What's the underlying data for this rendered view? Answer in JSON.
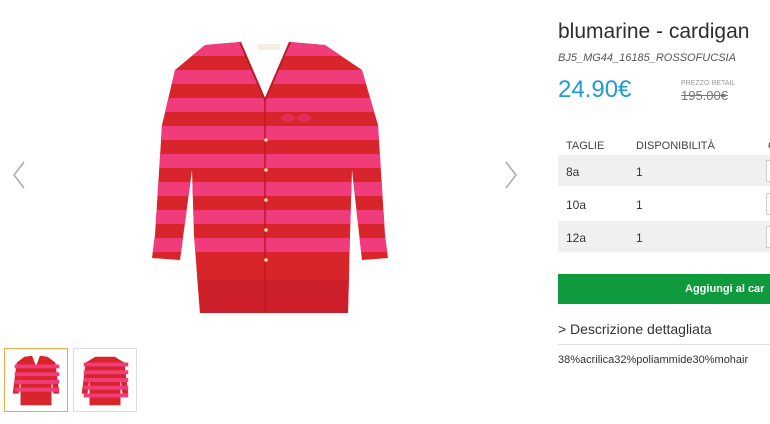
{
  "product": {
    "title": "blumarine - cardigan",
    "sku": "BJ5_MG44_16185_ROSSOFUCSIA",
    "price": "24.90€",
    "retail_label": "PREZZO RETAIL",
    "retail_price": "195.00€"
  },
  "sizes_table": {
    "headers": [
      "TAGLIE",
      "DISPONIBILITÀ",
      "Q"
    ],
    "rows": [
      {
        "size": "8a",
        "availability": "1"
      },
      {
        "size": "10a",
        "availability": "1"
      },
      {
        "size": "12a",
        "availability": "1"
      }
    ]
  },
  "cart_button": {
    "label": "Aggiungi al car"
  },
  "description": {
    "toggle_label": "Descrizione dettagliata",
    "chevron": ">",
    "composition": "38%acrilica32%poliammide30%mohair"
  },
  "gallery": {
    "thumbnail_count": 2,
    "active_index": 0,
    "colors": {
      "red": "#d8242b",
      "pink": "#f03c7a",
      "active_border": "#f0a64a"
    }
  },
  "colors": {
    "price": "#1f9bd6",
    "cart_button": "#0f9a3d"
  },
  "icons": {
    "prev": "chevron-left-icon",
    "next": "chevron-right-icon"
  }
}
